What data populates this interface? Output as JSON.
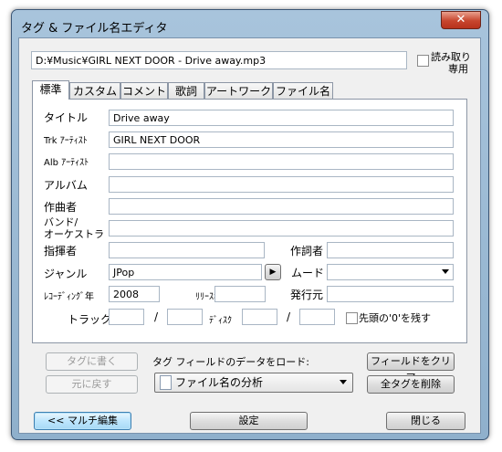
{
  "window": {
    "title": "タグ & ファイル名エディタ",
    "close_glyph": "✕"
  },
  "file_path": "D:¥Music¥GIRL NEXT DOOR - Drive away.mp3",
  "readonly_label_1": "読み取り",
  "readonly_label_2": "専用",
  "tabs": [
    {
      "label": "標準"
    },
    {
      "label": "カスタム"
    },
    {
      "label": "コメント"
    },
    {
      "label": "歌詞"
    },
    {
      "label": "アートワーク"
    },
    {
      "label": "ファイル名"
    }
  ],
  "fields": {
    "title_label": "タイトル",
    "title_value": "Drive away",
    "trk_artist_label": "Trk ｱｰﾃｨｽﾄ",
    "trk_artist_value": "GIRL NEXT DOOR",
    "alb_artist_label": "Alb ｱｰﾃｨｽﾄ",
    "alb_artist_value": "",
    "album_label": "アルバム",
    "album_value": "",
    "composer_label": "作曲者",
    "composer_value": "",
    "band_label_1": "バンド/",
    "band_label_2": "オーケストラ",
    "band_value": "",
    "conductor_label": "指揮者",
    "conductor_value": "",
    "lyricist_label": "作詞者",
    "lyricist_value": "",
    "genre_label": "ジャンル",
    "genre_value": "JPop",
    "genre_arrow": "▶",
    "mood_label": "ムード",
    "mood_value": "",
    "rec_year_label": "ﾚｺｰﾃﾞｨﾝｸﾞ年",
    "rec_year_value": "2008",
    "release_year_label": "ﾘﾘｰｽ年",
    "release_year_value": "",
    "publisher_label": "発行元",
    "publisher_value": "",
    "track_label": "トラック",
    "track_value": "",
    "track_total": "",
    "disc_label": "ﾃﾞｨｽｸ",
    "disc_value": "",
    "disc_total": "",
    "slash": "/",
    "keep_zero_label": "先頭の'0'を残す"
  },
  "actions": {
    "write_tag": "タグに書く",
    "revert": "元に戻す",
    "load_label": "タグ フィールドのデータをロード:",
    "load_select": "ファイル名の分析",
    "clear_fields": "フィールドをクリア",
    "delete_all": "全タグを削除"
  },
  "bottom": {
    "multi_edit": "<< マルチ編集",
    "settings": "設定",
    "close": "閉じる"
  }
}
